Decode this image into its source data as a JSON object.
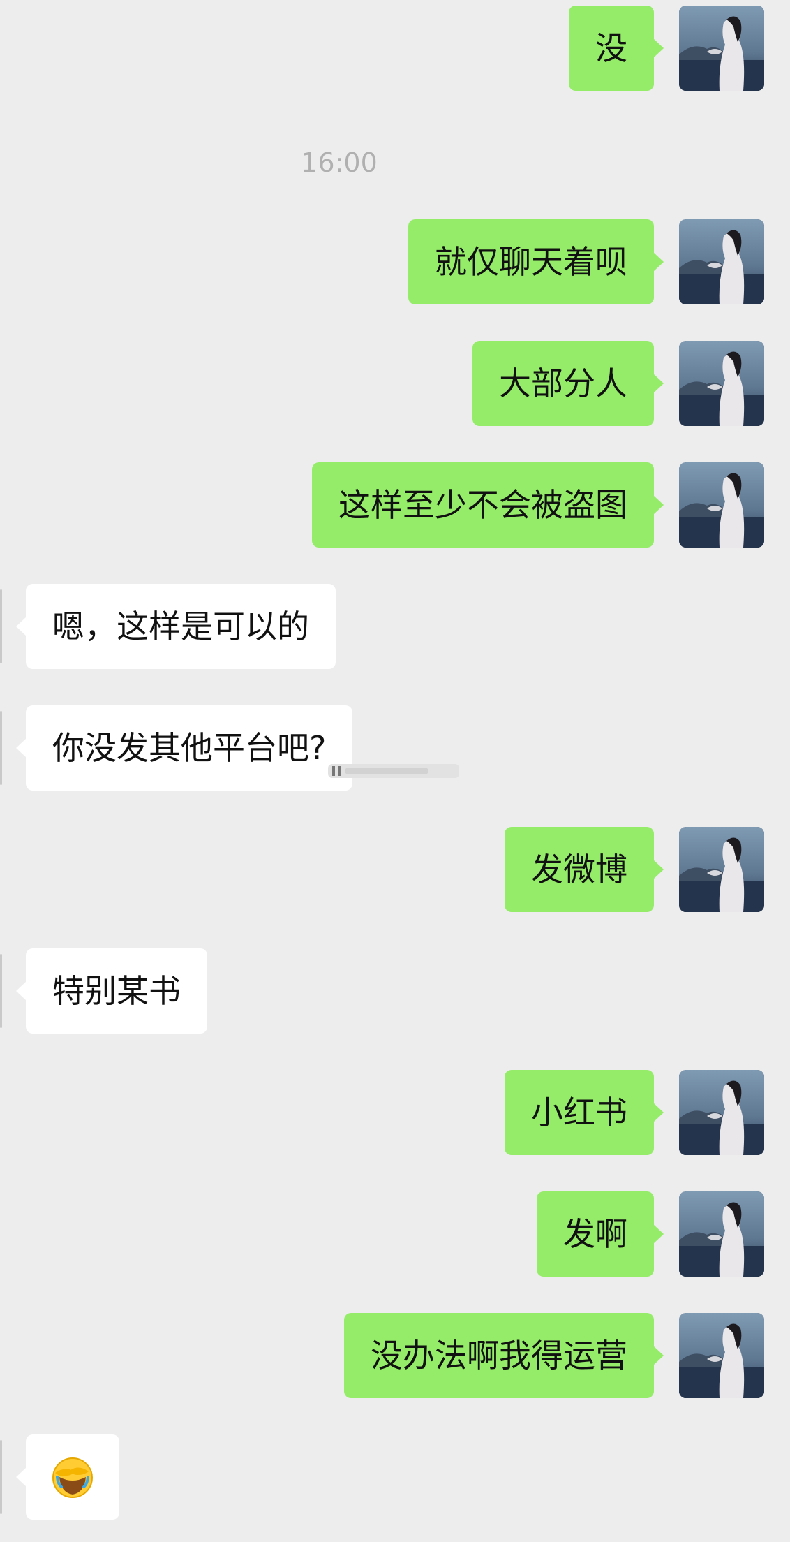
{
  "chat": {
    "timestamp": "16:00",
    "messages": [
      {
        "side": "out",
        "text": "没"
      },
      {
        "side": "out",
        "text": "就仅聊天着呗"
      },
      {
        "side": "out",
        "text": "大部分人"
      },
      {
        "side": "out",
        "text": "这样至少不会被盗图"
      },
      {
        "side": "in",
        "text": "嗯，这样是可以的"
      },
      {
        "side": "in",
        "text": "你没发其他平台吧?"
      },
      {
        "side": "out",
        "text": "发微博"
      },
      {
        "side": "in",
        "text": "特别某书"
      },
      {
        "side": "out",
        "text": "小红书"
      },
      {
        "side": "out",
        "text": "发啊"
      },
      {
        "side": "out",
        "text": "没办法啊我得运营"
      },
      {
        "side": "in",
        "emoji": "crying-face-with-hand-emoji"
      }
    ]
  },
  "colors": {
    "background": "#ededed",
    "outgoing_bubble": "#95ec69",
    "incoming_bubble": "#ffffff",
    "timestamp_text": "#b0b0b0"
  },
  "icons": {
    "avatar": "avatar-woman-seaside-photo",
    "last_message": "crying-face-with-hand-emoji"
  }
}
